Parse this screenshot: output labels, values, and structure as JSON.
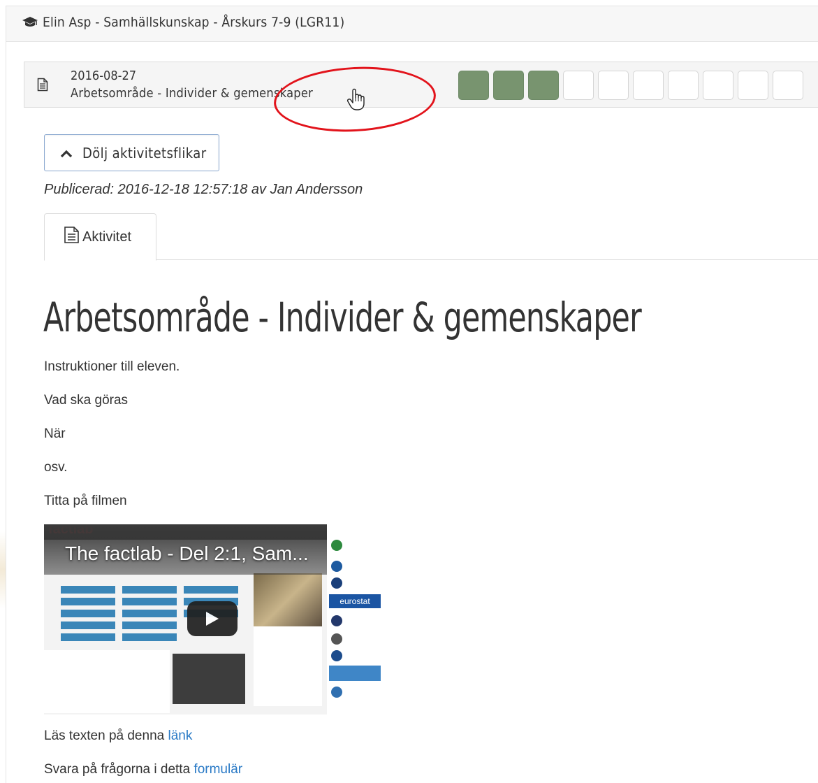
{
  "course": {
    "title": "Elin Asp - Samhällskunskap - Årskurs 7-9 (LGR11)"
  },
  "activity_header": {
    "date": "2016-08-27",
    "name": "Arbetsområde - Individer & gemenskaper",
    "progress": {
      "completed": 3,
      "total": 10,
      "done_color": "#78946f"
    }
  },
  "toggle_button": {
    "label": "Dölj aktivitetsflikar",
    "icon": "chevron-up-icon"
  },
  "published": "Publicerad: 2016-12-18 12:57:18 av Jan Andersson",
  "tabs": [
    {
      "label": "Aktivitet",
      "icon": "document-icon",
      "active": true
    }
  ],
  "content": {
    "title": "Arbetsområde - Individer & gemenskaper",
    "paragraphs": [
      "Instruktioner till eleven.",
      "Vad ska göras",
      "När",
      "osv.",
      "Titta på filmen"
    ],
    "video": {
      "title": "The factlab - Del 2:1, Sam...",
      "logo": "factlab",
      "eurostat_label": "eurostat"
    },
    "read_text": {
      "prefix": "Läs texten på denna ",
      "link": "länk"
    },
    "answer_text": {
      "prefix": "Svara på frågorna i detta ",
      "link": "formulär"
    }
  },
  "colors": {
    "accent_link": "#2a7ac6",
    "progress_done": "#78946f",
    "highlight_ring": "#e2131b"
  }
}
